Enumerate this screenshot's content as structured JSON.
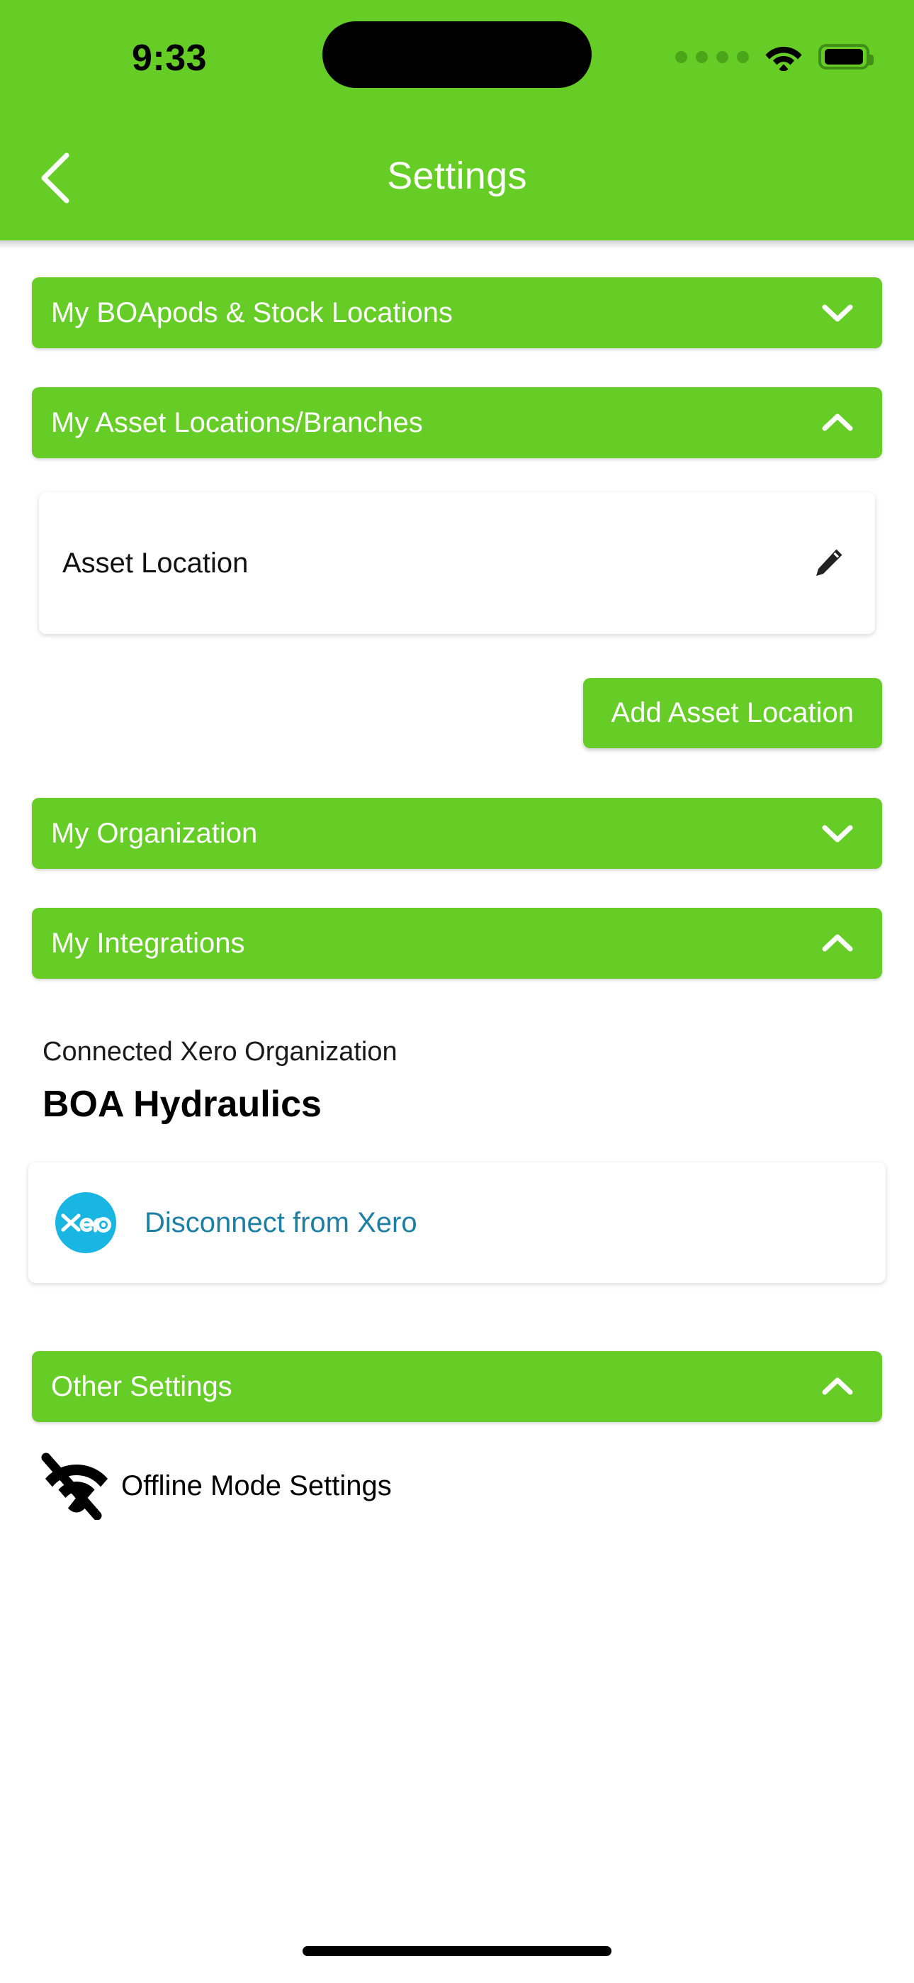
{
  "status_bar": {
    "time": "9:33",
    "signal_icon": "signal-dots-icon",
    "wifi_icon": "wifi-icon",
    "battery_icon": "battery-icon"
  },
  "header": {
    "title": "Settings",
    "back_icon": "chevron-left-icon"
  },
  "sections": {
    "boapods": {
      "label": "My BOApods & Stock Locations",
      "expanded": false,
      "chevron": "chevron-down-icon"
    },
    "asset_locations": {
      "label": "My Asset Locations/Branches",
      "expanded": true,
      "chevron": "chevron-up-icon",
      "items": [
        {
          "label": "Asset Location",
          "edit_icon": "pencil-icon"
        }
      ],
      "add_button_label": "Add Asset Location"
    },
    "organization": {
      "label": "My Organization",
      "expanded": false,
      "chevron": "chevron-down-icon"
    },
    "integrations": {
      "label": "My Integrations",
      "expanded": true,
      "chevron": "chevron-up-icon",
      "connected_caption": "Connected Xero Organization",
      "connected_org": "BOA Hydraulics",
      "xero_logo_text": "xero",
      "disconnect_label": "Disconnect from Xero"
    },
    "other": {
      "label": "Other Settings",
      "expanded": true,
      "chevron": "chevron-up-icon",
      "offline_label": "Offline Mode Settings",
      "offline_icon": "wifi-off-icon"
    }
  },
  "colors": {
    "brand_green": "#66cc26",
    "xero_blue": "#19b5e3",
    "link_blue": "#1c7fa3",
    "page_background": "#ffffff"
  }
}
